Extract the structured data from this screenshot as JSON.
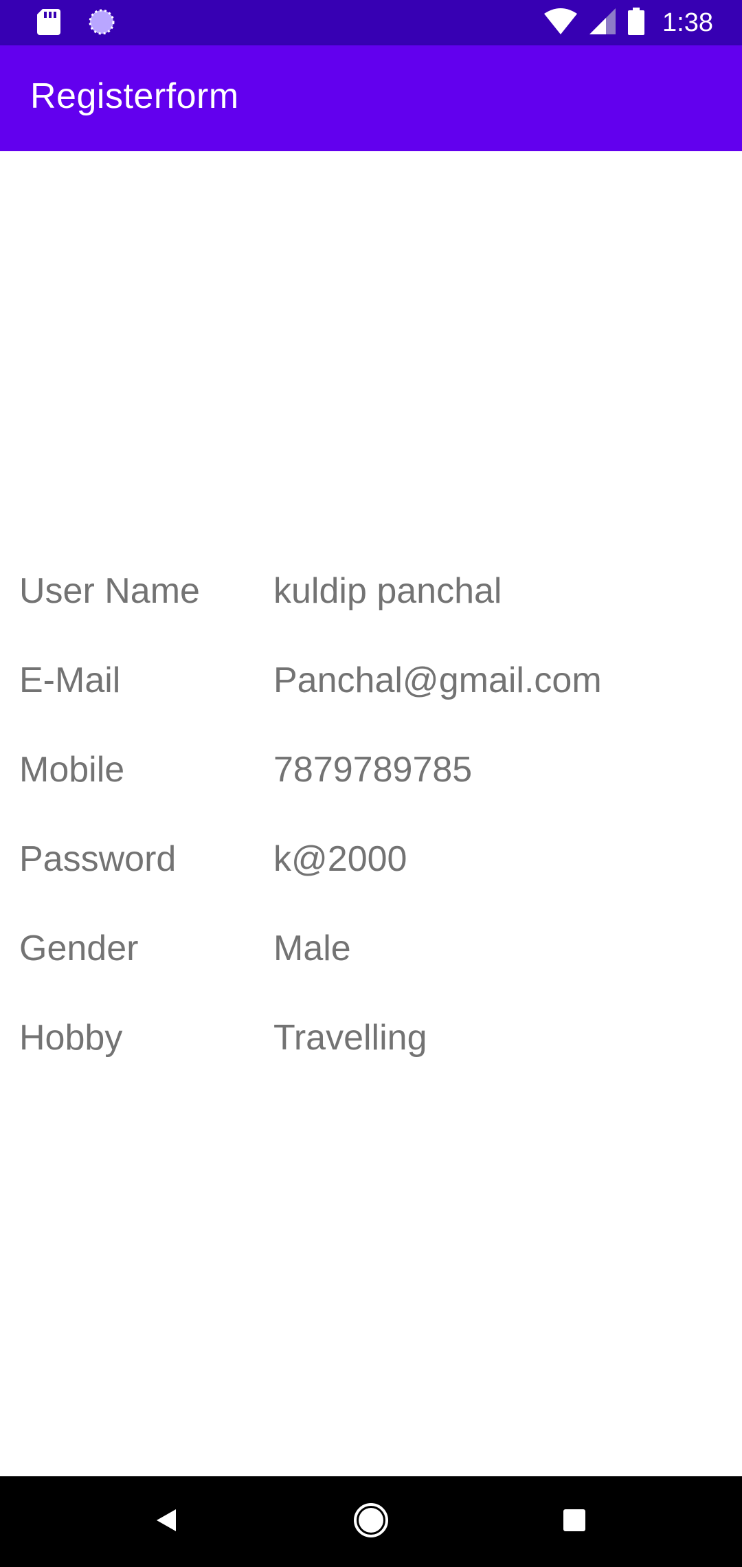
{
  "status_bar": {
    "time": "1:38",
    "left_icons": [
      "sd-card-icon",
      "sync-progress-icon"
    ],
    "right_icons": [
      "wifi-icon",
      "cellular-signal-icon",
      "battery-icon"
    ]
  },
  "app_bar": {
    "title": "Registerform"
  },
  "details": [
    {
      "label": "User Name",
      "value": "kuldip panchal"
    },
    {
      "label": "E-Mail",
      "value": "Panchal@gmail.com"
    },
    {
      "label": "Mobile",
      "value": "7879789785"
    },
    {
      "label": "Password",
      "value": "k@2000"
    },
    {
      "label": "Gender",
      "value": "Male"
    },
    {
      "label": "Hobby",
      "value": "Travelling"
    }
  ],
  "nav_bar": {
    "buttons": [
      "back-icon",
      "home-icon",
      "recents-icon"
    ]
  },
  "colors": {
    "status_bar": "#3700B3",
    "app_bar": "#6200EE",
    "text": "#737373",
    "nav_bar": "#000000"
  }
}
